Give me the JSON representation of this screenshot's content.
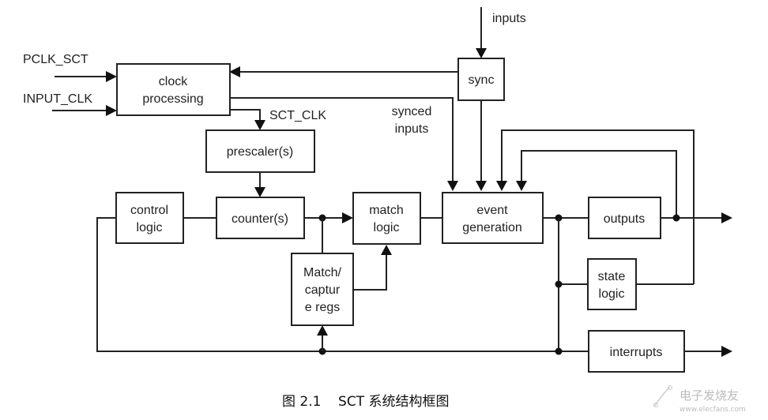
{
  "diagram": {
    "blocks": {
      "clock_processing": [
        "clock",
        "processing"
      ],
      "sync": [
        "sync"
      ],
      "prescaler": [
        "prescaler(s)"
      ],
      "control_logic": [
        "control",
        "logic"
      ],
      "counter": [
        "counter(s)"
      ],
      "match_logic": [
        "match",
        "logic"
      ],
      "match_capture_regs": [
        "Match/",
        "captur",
        "e regs"
      ],
      "event_generation": [
        "event",
        "generation"
      ],
      "outputs": [
        "outputs"
      ],
      "state_logic": [
        "state",
        "logic"
      ],
      "interrupts": [
        "interrupts"
      ]
    },
    "signals": {
      "pclk_sct": "PCLK_SCT",
      "input_clk": "INPUT_CLK",
      "sct_clk": "SCT_CLK",
      "inputs": "inputs",
      "synced_inputs": [
        "synced",
        "inputs"
      ]
    },
    "caption": "图 2.1    SCT 系统结构框图",
    "watermark": {
      "name": "电子发烧友",
      "url": "www.elecfans.com"
    }
  }
}
